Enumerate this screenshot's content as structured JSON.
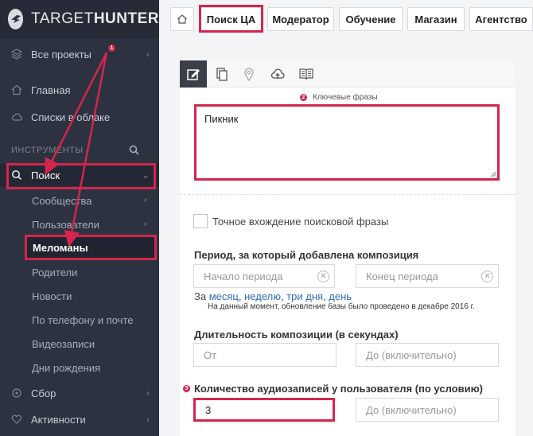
{
  "logo": {
    "text_light": "TARGET",
    "text_bold": "HUNTER"
  },
  "sidebar": {
    "all_projects": "Все проекты",
    "home": "Главная",
    "cloud_lists": "Списки в облаке",
    "tools_label": "ИНСТРУМЕНТЫ",
    "search": "Поиск",
    "sub": {
      "communities": "Сообщества",
      "users": "Пользователи",
      "music_lovers": "Меломаны",
      "parents": "Родители",
      "news": "Новости",
      "by_phone_mail": "По телефону и почте",
      "videos": "Видеозаписи",
      "birthdays": "Дни рождения"
    },
    "collect": "Сбор",
    "activity": "Активности"
  },
  "badges": {
    "one": "1",
    "two": "2",
    "three": "3"
  },
  "topnav": {
    "search_ca": "Поиск ЦА",
    "moderator": "Модератор",
    "training": "Обучение",
    "shop": "Магазин",
    "agency": "Агентство"
  },
  "form": {
    "keywords_label": "Ключевые фразы",
    "keywords_value": "Пикник",
    "exact_match_label": "Точное вхождение поисковой фразы",
    "period_title": "Период, за который добавлена композиция",
    "period_start_placeholder": "Начало периода",
    "period_end_placeholder": "Конец периода",
    "period_prefix": "За",
    "period_month": "месяц",
    "period_week": "неделю",
    "period_three_days": "три дня",
    "period_day": "день",
    "update_note": "На данный момент, обновление базы было проведено в декабре 2016 г.",
    "duration_title": "Длительность композиции (в секундах)",
    "duration_from": "От",
    "duration_to": "До (включительно)",
    "audio_count_title": "Количество аудиозаписей у пользователя (по условию)",
    "audio_count_value": "3",
    "audio_count_to": "До (включительно)"
  },
  "colors": {
    "accent_red": "#d4264c",
    "sidebar_bg": "#2c3240",
    "link_blue": "#2e6db4"
  }
}
